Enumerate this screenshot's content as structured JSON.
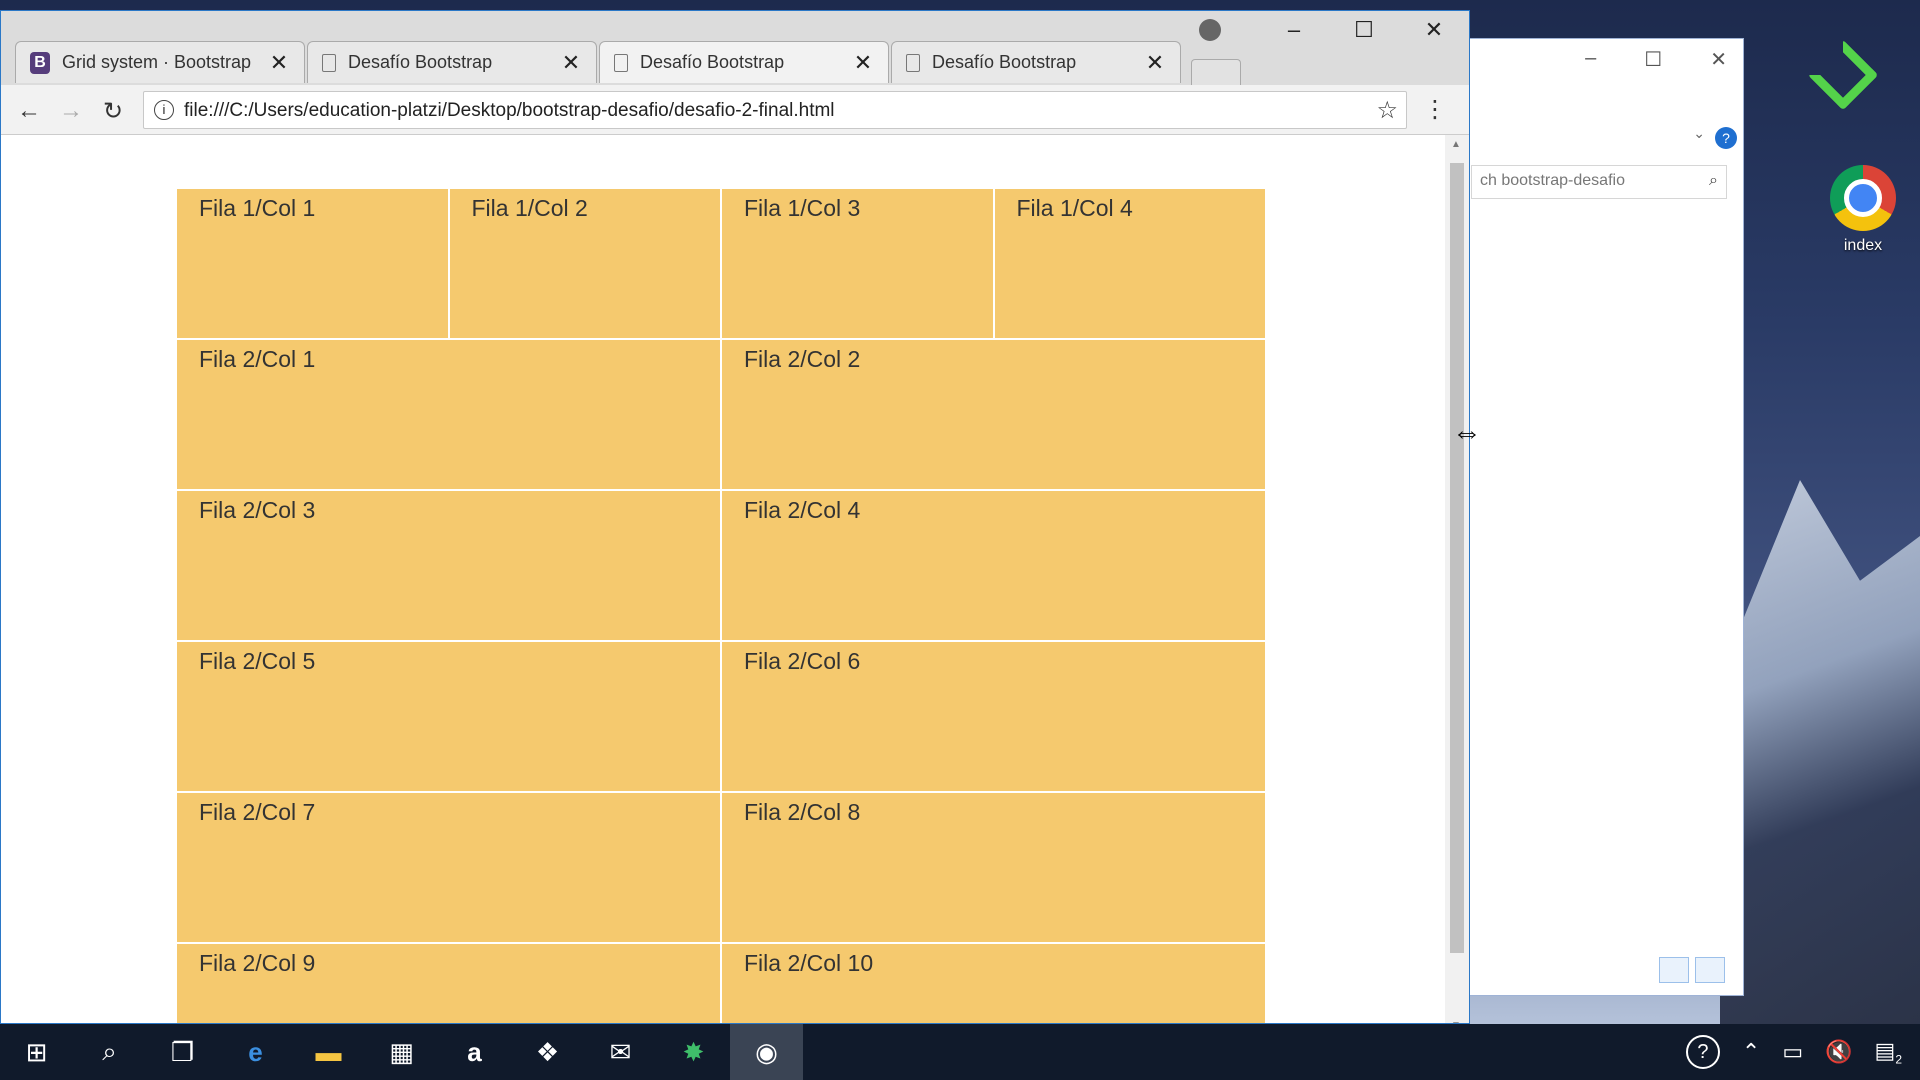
{
  "browser": {
    "tabs": [
      {
        "title": "Grid system · Bootstrap",
        "icon": "bootstrap-icon"
      },
      {
        "title": "Desafío Bootstrap",
        "icon": "document-icon"
      },
      {
        "title": "Desafío Bootstrap",
        "icon": "document-icon"
      },
      {
        "title": "Desafío Bootstrap",
        "icon": "document-icon"
      }
    ],
    "active_tab": 2,
    "url": "file:///C:/Users/education-platzi/Desktop/bootstrap-desafio/desafio-2-final.html",
    "window_controls": {
      "minimize": "–",
      "maximize": "☐",
      "close": "✕"
    }
  },
  "page": {
    "cell_color": "#f5c96e",
    "row1": [
      "Fila 1/Col 1",
      "Fila 1/Col 2",
      "Fila 1/Col 3",
      "Fila 1/Col 4"
    ],
    "row2": [
      "Fila 2/Col 1",
      "Fila 2/Col 2",
      "Fila 2/Col 3",
      "Fila 2/Col 4",
      "Fila 2/Col 5",
      "Fila 2/Col 6",
      "Fila 2/Col 7",
      "Fila 2/Col 8",
      "Fila 2/Col 9",
      "Fila 2/Col 10"
    ]
  },
  "explorer": {
    "search_text": "ch bootstrap-desafio"
  },
  "desktop": {
    "chrome_shortcut_label": "index"
  },
  "taskbar": {
    "items": [
      "start-icon",
      "search-icon",
      "task-view-icon",
      "edge-icon",
      "file-explorer-icon",
      "store-icon",
      "amazon-icon",
      "dropbox-icon",
      "mail-icon",
      "app-icon",
      "chrome-icon"
    ],
    "notification_count": "2"
  }
}
